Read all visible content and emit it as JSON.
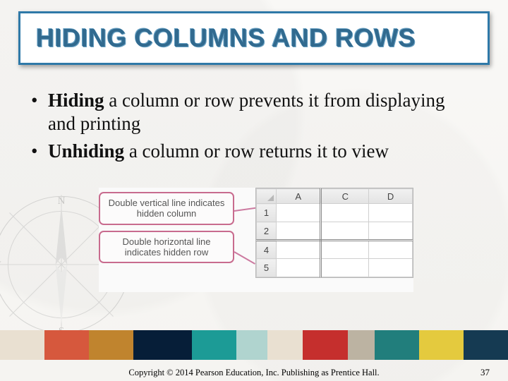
{
  "title": "HIDING COLUMNS AND ROWS",
  "bullets": [
    {
      "bold": "Hiding",
      "rest": " a column or row prevents it from displaying and printing"
    },
    {
      "bold": "Unhiding",
      "rest": " a column or row returns it to view"
    }
  ],
  "callouts": {
    "col": "Double vertical line indicates hidden column",
    "row": "Double horizontal line indicates hidden row"
  },
  "sheet": {
    "cols": [
      "A",
      "C",
      "D"
    ],
    "rows": [
      "1",
      "2",
      "4",
      "5"
    ]
  },
  "compass": {
    "n": "N",
    "s": "S",
    "w": "W"
  },
  "band_colors": [
    "#e9e0d1",
    "#d6583d",
    "#c0842e",
    "#061e38",
    "#1c9b96",
    "#b0d4cf",
    "#e9e0d1",
    "#c52f2d",
    "#bcb3a2",
    "#217e7c",
    "#e4ca3e",
    "#153a52"
  ],
  "footer": "Copyright © 2014 Pearson Education, Inc. Publishing as Prentice Hall.",
  "page": "37"
}
